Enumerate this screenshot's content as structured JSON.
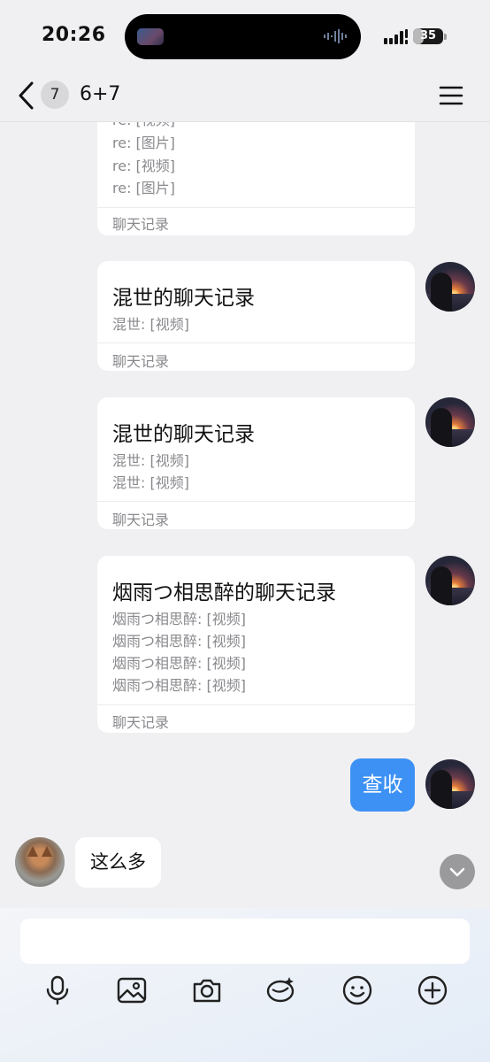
{
  "status_bar": {
    "time": "20:26",
    "battery_percent": 35,
    "battery_label": "35"
  },
  "nav": {
    "unread_count": "7",
    "title": "6+7"
  },
  "cards": [
    {
      "title": "",
      "lines": [
        "re: [视频]",
        "re: [图片]",
        "re: [视频]",
        "re: [图片]"
      ],
      "footer": "聊天记录"
    },
    {
      "title": "混世的聊天记录",
      "lines": [
        "混世: [视频]"
      ],
      "footer": "聊天记录"
    },
    {
      "title": "混世的聊天记录",
      "lines": [
        "混世: [视频]",
        "混世: [视频]"
      ],
      "footer": "聊天记录"
    },
    {
      "title": "烟雨つ相思醉的聊天记录",
      "lines": [
        "烟雨つ相思醉: [视频]",
        "烟雨つ相思醉: [视频]",
        "烟雨つ相思醉: [视频]",
        "烟雨つ相思醉: [视频]"
      ],
      "footer": "聊天记录"
    }
  ],
  "messages": {
    "sent": "查收",
    "received": "这么多"
  },
  "input": {
    "value": "",
    "placeholder": ""
  },
  "toolbar": {
    "icons": [
      "microphone-icon",
      "image-icon",
      "camera-icon",
      "sticker-icon",
      "emoji-icon",
      "plus-icon"
    ]
  },
  "colors": {
    "accent_blue": "#3d91f5",
    "background": "#f0f0f2",
    "card": "#ffffff",
    "muted_text": "#8a8a8e"
  }
}
